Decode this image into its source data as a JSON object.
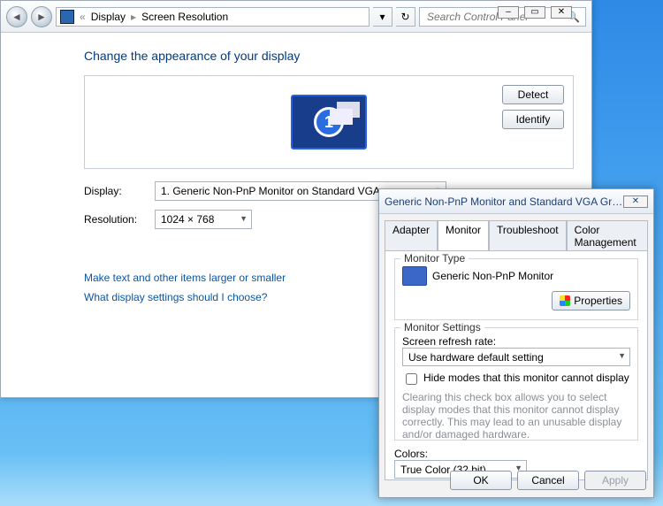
{
  "titlebar": {
    "min": "–",
    "max": "▭",
    "close": "✕"
  },
  "nav": {
    "back_glyph": "◄",
    "fwd_glyph": "►",
    "root": "Display",
    "page": "Screen Resolution",
    "refresh_glyph": "↻",
    "search_placeholder": "Search Control Panel"
  },
  "heading": "Change the appearance of your display",
  "monitor_box": {
    "number": "1",
    "detect": "Detect",
    "identify": "Identify"
  },
  "fields": {
    "display_label": "Display:",
    "display_value": "1. Generic Non-PnP Monitor on Standard VGA",
    "resolution_label": "Resolution:",
    "resolution_value": "1024 × 768"
  },
  "links": {
    "larger": "Make text and other items larger or smaller",
    "which": "What display settings should I choose?"
  },
  "props": {
    "title": "Generic Non-PnP Monitor and Standard VGA Graphics Adapter Pro...",
    "tabs": {
      "adapter": "Adapter",
      "monitor": "Monitor",
      "trouble": "Troubleshoot",
      "color": "Color Management"
    },
    "type_legend": "Monitor Type",
    "type_name": "Generic Non-PnP Monitor",
    "properties_btn": "Properties",
    "settings_legend": "Monitor Settings",
    "refresh_label": "Screen refresh rate:",
    "refresh_value": "Use hardware default setting",
    "hide_label": "Hide modes that this monitor cannot display",
    "hide_hint": "Clearing this check box allows you to select display modes that this monitor cannot display correctly. This may lead to an unusable display and/or damaged hardware.",
    "colors_label": "Colors:",
    "colors_value": "True Color (32 bit)",
    "buttons": {
      "ok": "OK",
      "cancel": "Cancel",
      "apply": "Apply"
    }
  }
}
